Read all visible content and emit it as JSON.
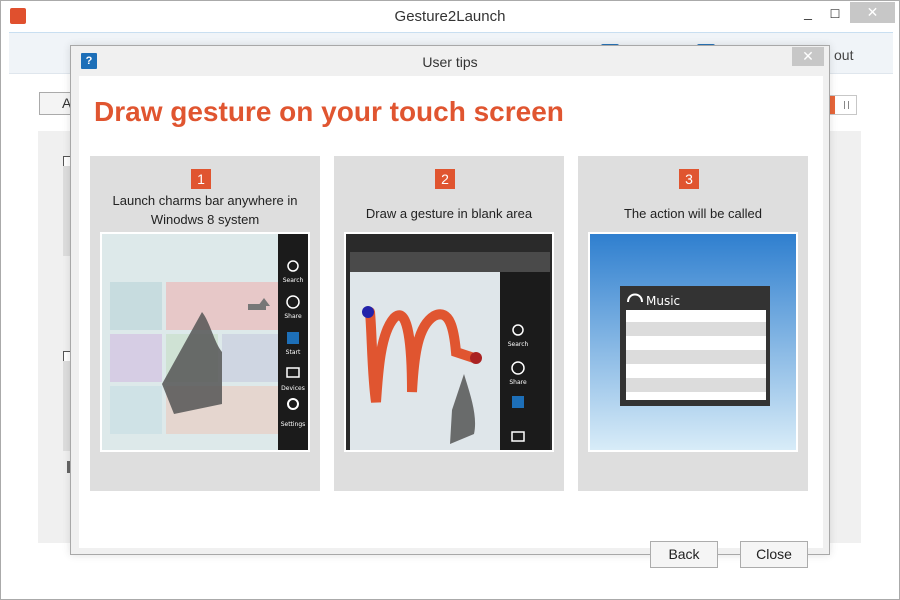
{
  "window": {
    "title": "Gesture2Launch"
  },
  "main_header": {
    "about_label": "out"
  },
  "main": {
    "button_label": "A"
  },
  "dialog": {
    "title": "User tips",
    "help_glyph": "?",
    "headline": "Draw gesture on your touch screen",
    "steps": [
      {
        "number": "1",
        "text_line1": "Launch charms bar anywhere in",
        "text_line2": "Winodws 8 system"
      },
      {
        "number": "2",
        "text_line1": "Draw a gesture in blank area"
      },
      {
        "number": "3",
        "text_line1": "The action will be called"
      }
    ],
    "charms": [
      "Search",
      "Share",
      "Start",
      "Devices",
      "Settings"
    ],
    "charms2": [
      "Search",
      "Share"
    ],
    "music_label": "Music",
    "buttons": {
      "back": "Back",
      "close": "Close"
    }
  },
  "colors": {
    "accent": "#e05530",
    "step_bg": "#dedede",
    "tile_blue": "#1d6fb8"
  },
  "icons": [
    "app-icon",
    "help-icon",
    "close-icon",
    "minimize-icon",
    "maximize-icon",
    "search-icon",
    "share-icon",
    "start-icon",
    "devices-icon",
    "settings-icon",
    "headphones-icon"
  ]
}
